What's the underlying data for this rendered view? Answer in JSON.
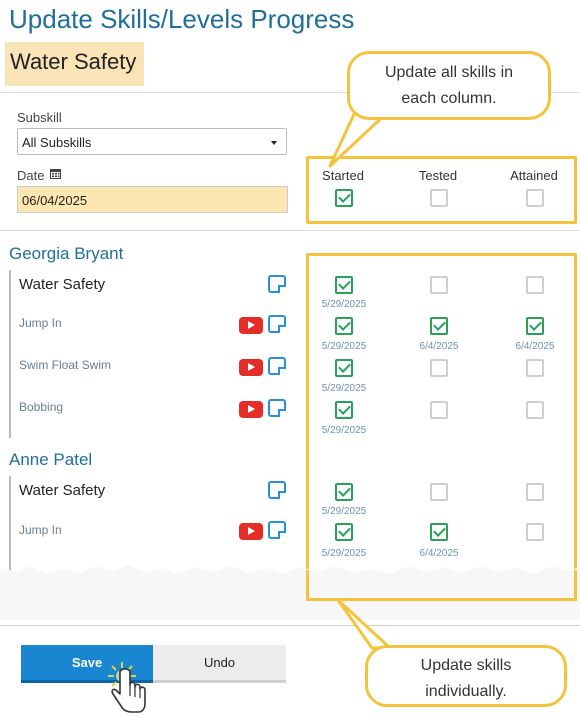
{
  "title": "Update Skills/Levels Progress",
  "skill_name": "Water Safety",
  "filters": {
    "subskill_label": "Subskill",
    "subskill_value": "All Subskills",
    "date_label": "Date",
    "date_value": "06/04/2025"
  },
  "columns": {
    "started": "Started",
    "tested": "Tested",
    "attained": "Attained"
  },
  "students": [
    {
      "name": "Georgia Bryant",
      "skills": [
        {
          "label": "Water Safety",
          "main": true,
          "video": false,
          "started": true,
          "started_date": "5/29/2025",
          "tested": false,
          "tested_date": "",
          "attained": false,
          "attained_date": ""
        },
        {
          "label": "Jump In",
          "main": false,
          "video": true,
          "started": true,
          "started_date": "5/29/2025",
          "tested": true,
          "tested_date": "6/4/2025",
          "attained": true,
          "attained_date": "6/4/2025"
        },
        {
          "label": "Swim Float Swim",
          "main": false,
          "video": true,
          "started": true,
          "started_date": "5/29/2025",
          "tested": false,
          "tested_date": "",
          "attained": false,
          "attained_date": ""
        },
        {
          "label": "Bobbing",
          "main": false,
          "video": true,
          "started": true,
          "started_date": "5/29/2025",
          "tested": false,
          "tested_date": "",
          "attained": false,
          "attained_date": ""
        }
      ]
    },
    {
      "name": "Anne Patel",
      "skills": [
        {
          "label": "Water Safety",
          "main": true,
          "video": false,
          "started": true,
          "started_date": "5/29/2025",
          "tested": false,
          "tested_date": "",
          "attained": false,
          "attained_date": ""
        },
        {
          "label": "Jump In",
          "main": false,
          "video": true,
          "started": true,
          "started_date": "5/29/2025",
          "tested": true,
          "tested_date": "6/4/2025",
          "attained": false,
          "attained_date": ""
        }
      ]
    }
  ],
  "callouts": {
    "top_line1": "Update all skills in",
    "top_line2": "each column.",
    "bottom_line1": "Update skills",
    "bottom_line2": "individually."
  },
  "buttons": {
    "save": "Save",
    "undo": "Undo"
  },
  "colors": {
    "accent": "#1f6f9a",
    "highlight": "#f5c33b",
    "check": "#2aa15a",
    "save": "#1a86d1"
  }
}
